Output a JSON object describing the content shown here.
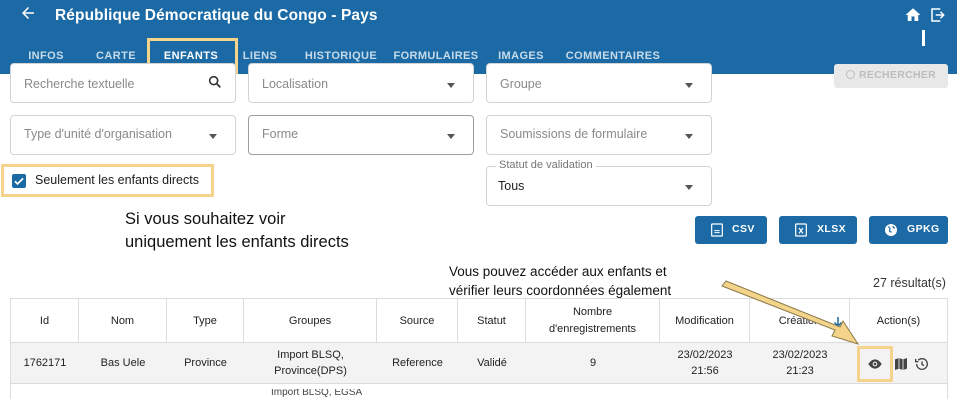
{
  "header": {
    "title": "République Démocratique du Congo - Pays",
    "icons": [
      "back-arrow-icon",
      "home-icon",
      "logout-icon"
    ]
  },
  "tabs": [
    {
      "label": "INFOS"
    },
    {
      "label": "CARTE"
    },
    {
      "label": "ENFANTS",
      "active": true
    },
    {
      "label": "LIENS"
    },
    {
      "label": "HISTORIQUE"
    },
    {
      "label": "FORMULAIRES"
    },
    {
      "label": "IMAGES"
    },
    {
      "label": "COMMENTAIRES"
    }
  ],
  "filters": {
    "search_placeholder": "Recherche textuelle",
    "localisation": "Localisation",
    "groupe": "Groupe",
    "type_unite": "Type d'unité d'organisation",
    "forme": "Forme",
    "soumissions": "Soumissions de formulaire",
    "statut_label": "Statut de validation",
    "statut_value": "Tous",
    "search_button": "RECHERCHER",
    "direct_children_label": "Seulement les enfants directs",
    "direct_children_checked": true
  },
  "annotations": {
    "direct_children_note": "Si vous souhaitez voir\nuniquement les enfants directs",
    "actions_note": "Vous pouvez accéder aux enfants et\nvérifier leurs coordonnées également"
  },
  "exports": {
    "csv": "CSV",
    "xlsx": "XLSX",
    "gpkg": "GPKG"
  },
  "results_count": "27 résultat(s)",
  "table": {
    "headers": {
      "id": "Id",
      "nom": "Nom",
      "type": "Type",
      "groupes": "Groupes",
      "source": "Source",
      "statut": "Statut",
      "nb_line1": "Nombre",
      "nb_line2": "d'enregistrements",
      "modification": "Modification",
      "creation": "Création",
      "actions": "Action(s)"
    },
    "rows": [
      {
        "id": "1762171",
        "nom": "Bas Uele",
        "type": "Province",
        "groupes_1": "Import BLSQ,",
        "groupes_2": "Province(DPS)",
        "source": "Reference",
        "statut": "Validé",
        "nb": "9",
        "modif_date": "23/02/2023",
        "modif_time": "21:56",
        "creation_date": "23/02/2023",
        "creation_time": "21:23"
      }
    ],
    "partial_next_row_groupes": "Import BLSQ, EGSA"
  },
  "colors": {
    "primary": "#1b6aa5",
    "highlight": "#f4d38a"
  }
}
